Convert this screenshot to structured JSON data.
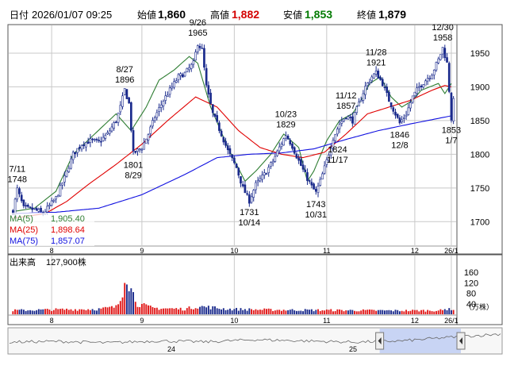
{
  "header": {
    "date_label": "日付",
    "datetime": "2026/01/07 09:25",
    "items": [
      {
        "label": "始値",
        "value": "1,860",
        "color": "#000000"
      },
      {
        "label": "高値",
        "value": "1,882",
        "color": "#d40000"
      },
      {
        "label": "安値",
        "value": "1,853",
        "color": "#007a00"
      },
      {
        "label": "終値",
        "value": "1,879",
        "color": "#000000"
      }
    ]
  },
  "legend": [
    {
      "label": "MA(5)",
      "value": "1,905.40",
      "color": "#2e7d32"
    },
    {
      "label": "MA(25)",
      "value": "1,898.64",
      "color": "#e00000"
    },
    {
      "label": "MA(75)",
      "value": "1,857.07",
      "color": "#1010e0"
    }
  ],
  "volume": {
    "label": "出来高",
    "value": "127,900株",
    "unit": "（万株）"
  },
  "navigator": {
    "labels": [
      {
        "text": "24",
        "pos": 0.37
      },
      {
        "text": "25",
        "pos": 0.74
      }
    ]
  },
  "colors": {
    "up": "#ffffff",
    "down": "#1a2a8c",
    "vol_up": "#e01818",
    "vol_down": "#1a2a8c",
    "grid": "#c8c8c8"
  },
  "chart_data": {
    "type": "candlestick",
    "x_tick_labels": [
      "8",
      "9",
      "10",
      "11",
      "12",
      "26/1"
    ],
    "y_ticks": [
      1700,
      1750,
      1800,
      1850,
      1900,
      1950
    ],
    "ylim": [
      1665,
      1990
    ],
    "volume_ticks": [
      40,
      80,
      120,
      160
    ],
    "volume_ylim": [
      0,
      185
    ],
    "series": [
      {
        "name": "MA(5)",
        "anchors": [
          [
            0,
            1715
          ],
          [
            10,
            1720
          ],
          [
            20,
            1745
          ],
          [
            28,
            1800
          ],
          [
            38,
            1830
          ],
          [
            48,
            1860
          ],
          [
            55,
            1835
          ],
          [
            62,
            1870
          ],
          [
            68,
            1910
          ],
          [
            75,
            1925
          ],
          [
            82,
            1945
          ],
          [
            86,
            1935
          ],
          [
            92,
            1870
          ],
          [
            100,
            1810
          ],
          [
            108,
            1760
          ],
          [
            113,
            1775
          ],
          [
            120,
            1800
          ],
          [
            126,
            1830
          ],
          [
            133,
            1810
          ],
          [
            137,
            1760
          ],
          [
            140,
            1775
          ],
          [
            146,
            1820
          ],
          [
            152,
            1850
          ],
          [
            158,
            1860
          ],
          [
            162,
            1880
          ],
          [
            166,
            1905
          ],
          [
            171,
            1915
          ],
          [
            176,
            1885
          ],
          [
            181,
            1870
          ],
          [
            186,
            1880
          ],
          [
            190,
            1895
          ],
          [
            194,
            1900
          ],
          [
            198,
            1905
          ],
          [
            201,
            1890
          ],
          [
            204,
            1905
          ]
        ]
      },
      {
        "name": "MA(25)",
        "anchors": [
          [
            0,
            1705
          ],
          [
            15,
            1712
          ],
          [
            25,
            1730
          ],
          [
            35,
            1755
          ],
          [
            48,
            1785
          ],
          [
            60,
            1815
          ],
          [
            72,
            1850
          ],
          [
            85,
            1885
          ],
          [
            95,
            1870
          ],
          [
            105,
            1835
          ],
          [
            115,
            1810
          ],
          [
            125,
            1800
          ],
          [
            135,
            1795
          ],
          [
            145,
            1803
          ],
          [
            155,
            1830
          ],
          [
            165,
            1860
          ],
          [
            175,
            1870
          ],
          [
            185,
            1880
          ],
          [
            195,
            1895
          ],
          [
            201,
            1902
          ],
          [
            204,
            1900
          ]
        ]
      },
      {
        "name": "MA(75)",
        "anchors": [
          [
            0,
            1712
          ],
          [
            20,
            1714
          ],
          [
            40,
            1720
          ],
          [
            60,
            1740
          ],
          [
            80,
            1770
          ],
          [
            95,
            1795
          ],
          [
            110,
            1800
          ],
          [
            125,
            1802
          ],
          [
            140,
            1808
          ],
          [
            155,
            1822
          ],
          [
            170,
            1835
          ],
          [
            185,
            1845
          ],
          [
            204,
            1857
          ]
        ]
      }
    ],
    "price_anchors": [
      [
        0,
        1715
      ],
      [
        2,
        1748
      ],
      [
        5,
        1720
      ],
      [
        10,
        1718
      ],
      [
        14,
        1712
      ],
      [
        20,
        1735
      ],
      [
        24,
        1765
      ],
      [
        28,
        1800
      ],
      [
        32,
        1815
      ],
      [
        36,
        1820
      ],
      [
        40,
        1818
      ],
      [
        44,
        1830
      ],
      [
        48,
        1850
      ],
      [
        50,
        1870
      ],
      [
        52,
        1896
      ],
      [
        54,
        1875
      ],
      [
        56,
        1801
      ],
      [
        60,
        1810
      ],
      [
        63,
        1830
      ],
      [
        66,
        1855
      ],
      [
        70,
        1880
      ],
      [
        74,
        1900
      ],
      [
        77,
        1915
      ],
      [
        80,
        1920
      ],
      [
        84,
        1935
      ],
      [
        86,
        1965
      ],
      [
        88,
        1955
      ],
      [
        90,
        1900
      ],
      [
        93,
        1860
      ],
      [
        97,
        1830
      ],
      [
        100,
        1805
      ],
      [
        104,
        1780
      ],
      [
        107,
        1750
      ],
      [
        110,
        1731
      ],
      [
        113,
        1755
      ],
      [
        117,
        1770
      ],
      [
        121,
        1790
      ],
      [
        124,
        1810
      ],
      [
        127,
        1829
      ],
      [
        130,
        1812
      ],
      [
        133,
        1790
      ],
      [
        136,
        1770
      ],
      [
        139,
        1752
      ],
      [
        141,
        1743
      ],
      [
        143,
        1760
      ],
      [
        146,
        1790
      ],
      [
        149,
        1824
      ],
      [
        152,
        1845
      ],
      [
        155,
        1857
      ],
      [
        158,
        1850
      ],
      [
        161,
        1875
      ],
      [
        164,
        1900
      ],
      [
        167,
        1915
      ],
      [
        169,
        1921
      ],
      [
        172,
        1905
      ],
      [
        175,
        1880
      ],
      [
        178,
        1860
      ],
      [
        180,
        1846
      ],
      [
        183,
        1860
      ],
      [
        186,
        1885
      ],
      [
        189,
        1900
      ],
      [
        192,
        1910
      ],
      [
        195,
        1920
      ],
      [
        198,
        1940
      ],
      [
        200,
        1958
      ],
      [
        202,
        1935
      ],
      [
        203,
        1895
      ],
      [
        204,
        1853
      ],
      [
        205,
        1879
      ]
    ],
    "volume_anchors": [
      [
        0,
        15
      ],
      [
        20,
        18
      ],
      [
        40,
        20
      ],
      [
        48,
        28
      ],
      [
        50,
        55
      ],
      [
        51,
        90
      ],
      [
        52,
        160
      ],
      [
        53,
        150
      ],
      [
        55,
        95
      ],
      [
        58,
        40
      ],
      [
        65,
        24
      ],
      [
        80,
        20
      ],
      [
        86,
        30
      ],
      [
        90,
        28
      ],
      [
        100,
        20
      ],
      [
        120,
        17
      ],
      [
        140,
        16
      ],
      [
        160,
        15
      ],
      [
        180,
        14
      ],
      [
        200,
        15
      ],
      [
        203,
        25
      ],
      [
        205,
        13
      ]
    ],
    "navigator_curve": [
      [
        0,
        0.45
      ],
      [
        0.1,
        0.48
      ],
      [
        0.2,
        0.42
      ],
      [
        0.3,
        0.5
      ],
      [
        0.4,
        0.46
      ],
      [
        0.5,
        0.55
      ],
      [
        0.6,
        0.5
      ],
      [
        0.7,
        0.45
      ],
      [
        0.8,
        0.5
      ],
      [
        0.9,
        0.65
      ],
      [
        1.0,
        0.78
      ]
    ],
    "selection_range": [
      0.77,
      1.0
    ],
    "annotations": [
      {
        "text": "7/11",
        "sub": "1748",
        "x": 2,
        "price": 1748,
        "pos": "above"
      },
      {
        "text": "8/27",
        "sub": "1896",
        "x": 52,
        "price": 1896,
        "pos": "above"
      },
      {
        "text": "1801",
        "sub": "8/29",
        "x": 56,
        "price": 1801,
        "pos": "below"
      },
      {
        "text": "9/26",
        "sub": "1965",
        "x": 86,
        "price": 1965,
        "pos": "above"
      },
      {
        "text": "10/23",
        "sub": "1829",
        "x": 127,
        "price": 1829,
        "pos": "above"
      },
      {
        "text": "1731",
        "sub": "10/14",
        "x": 110,
        "price": 1731,
        "pos": "below"
      },
      {
        "text": "11/12",
        "sub": "1857",
        "x": 155,
        "price": 1857,
        "pos": "above"
      },
      {
        "text": "1743",
        "sub": "10/31",
        "x": 141,
        "price": 1743,
        "pos": "below"
      },
      {
        "text": "1824",
        "sub": "11/17",
        "x": 151,
        "price": 1824,
        "pos": "below"
      },
      {
        "text": "11/28",
        "sub": "1921",
        "x": 169,
        "price": 1921,
        "pos": "above"
      },
      {
        "text": "1846",
        "sub": "12/8",
        "x": 180,
        "price": 1846,
        "pos": "below"
      },
      {
        "text": "12/30",
        "sub": "1958",
        "x": 200,
        "price": 1958,
        "pos": "above"
      },
      {
        "text": "1853",
        "sub": "1/7",
        "x": 204,
        "price": 1853,
        "pos": "below"
      }
    ]
  }
}
